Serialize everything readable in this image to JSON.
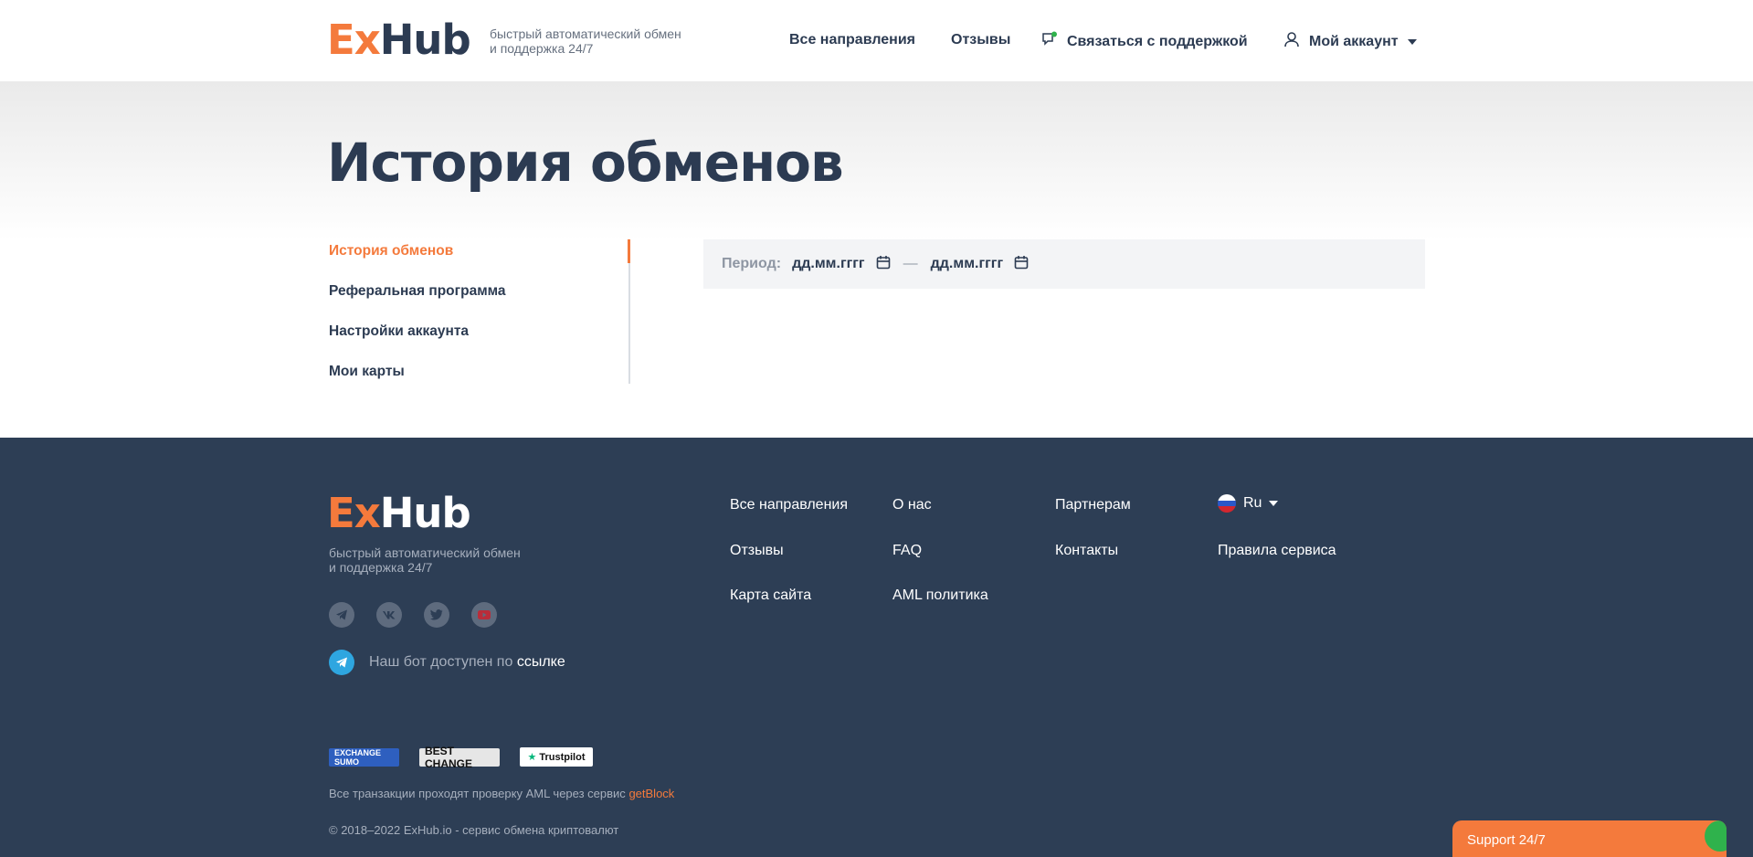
{
  "header": {
    "logo": {
      "ex": "Ex",
      "hub": "Hub"
    },
    "tagline_line1": "быстрый автоматический обмен",
    "tagline_line2": "и поддержка 24/7",
    "nav": {
      "directions": "Все направления",
      "reviews": "Отзывы",
      "support": "Связаться с поддержкой",
      "account": "Мой аккаунт"
    }
  },
  "page": {
    "title": "История обменов"
  },
  "side_menu": {
    "items": [
      {
        "label": "История обменов",
        "active": true
      },
      {
        "label": "Реферальная программа",
        "active": false
      },
      {
        "label": "Настройки аккаунта",
        "active": false
      },
      {
        "label": "Мои карты",
        "active": false
      }
    ]
  },
  "period": {
    "label": "Период:",
    "from_placeholder": "дд.мм.гггг",
    "separator": "—",
    "to_placeholder": "дд.мм.гггг"
  },
  "footer": {
    "logo": {
      "ex": "Ex",
      "hub": "Hub"
    },
    "tagline_line1": "быстрый автоматический обмен",
    "tagline_line2": "и поддержка 24/7",
    "socials": [
      "telegram-icon",
      "vk-icon",
      "twitter-icon",
      "youtube-icon"
    ],
    "bot_text": "Наш бот доступен по",
    "bot_link": "ссылке",
    "links": {
      "directions": "Все направления",
      "reviews": "Отзывы",
      "sitemap": "Карта сайта",
      "about": "О нас",
      "faq": "FAQ",
      "aml": "AML политика",
      "partners": "Партнерам",
      "contacts": "Контакты",
      "rules": "Правила сервиса"
    },
    "language": "Ru",
    "badges": {
      "sumo": "EXCHANGE SUMO",
      "bestchange": "BEST CHANGE",
      "trustpilot": "Trustpilot"
    },
    "aml_text": "Все транзакции проходят проверку AML через сервис",
    "aml_link": "getBlock",
    "copyright": "© 2018–2022 ExHub.io - сервис обмена криптовалют"
  },
  "support_widget": {
    "label": "Support 24/7"
  },
  "colors": {
    "accent": "#f47a3c",
    "dark": "#2c3b52",
    "footer_bg": "#2d3e55",
    "online": "#2fb24c"
  }
}
